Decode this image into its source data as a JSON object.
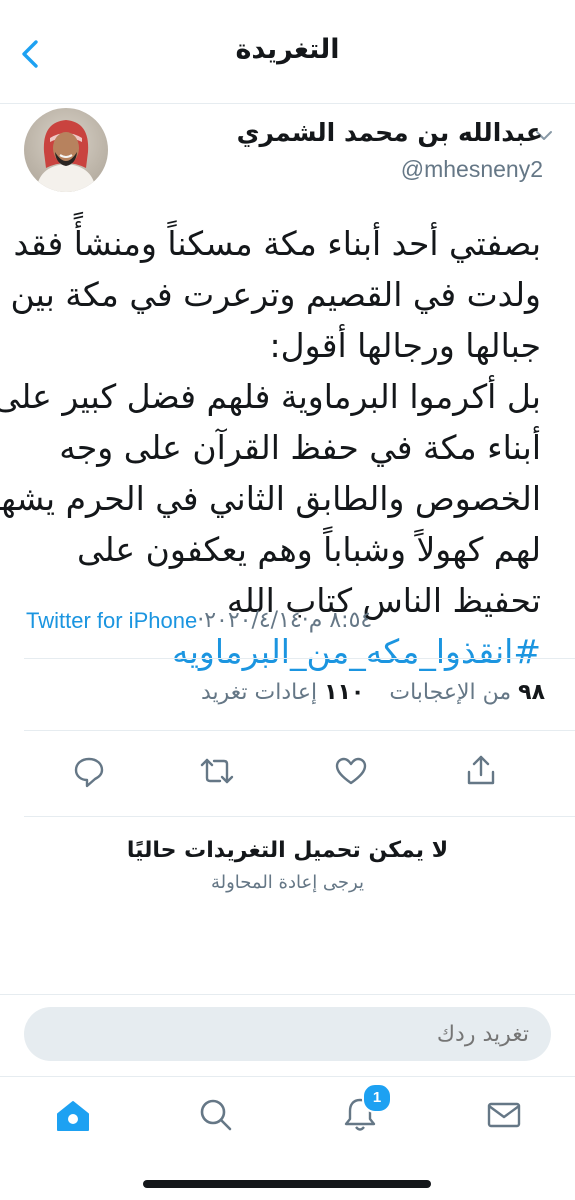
{
  "header": {
    "title": "التغريدة"
  },
  "tweet": {
    "author_name": "عبدالله بن محمد الشمري",
    "author_handle": "@mhesneny2",
    "body_lines": [
      "بصفتي أحد أبناء مكة مسكناً ومنشأً فقد",
      "ولدت في القصيم وترعرت في مكة بين",
      "جبالها ورجالها أقول:",
      "بل أكرموا البرماوية فلهم فضل كبير على",
      "أبناء مكة في حفظ القرآن على وجه",
      "الخصوص والطابق الثاني في الحرم يشهد",
      "لهم كهولاً وشباباً وهم يعكفون على",
      "تحفيظ الناس كتاب الله"
    ],
    "hashtag": "#انقذوا_مكه_من_البرماويه",
    "time": "٨:٥٤ م",
    "date": "٢٠٢٠/٤/١٤",
    "separator": " · ",
    "source": "Twitter for iPhone",
    "likes_count": "٩٨",
    "likes_label": "من الإعجابات",
    "retweets_count": "١١٠",
    "retweets_label": "إعادات تغريد"
  },
  "load_error": {
    "message": "لا يمكن تحميل التغريدات حاليًا",
    "retry": "يرجى إعادة المحاولة"
  },
  "reply": {
    "placeholder": "تغريد ردك"
  },
  "tabs": {
    "notifications_badge": "1"
  },
  "colors": {
    "accent": "#1da1f2",
    "link": "#1b95e0",
    "secondary": "#657786",
    "divider": "#e6ecf0"
  }
}
